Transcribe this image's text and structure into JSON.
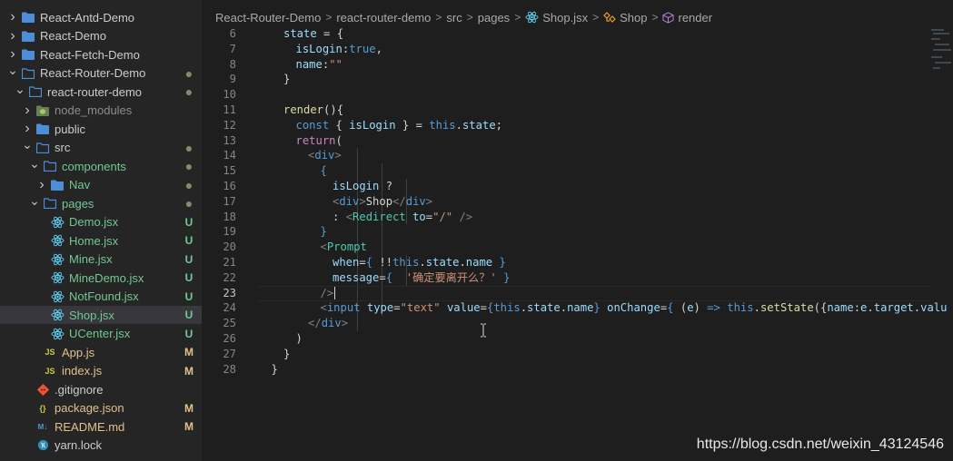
{
  "explorer": {
    "items": [
      {
        "label": "React-Antd-Demo",
        "type": "folder",
        "chevron": "right",
        "indent": 0
      },
      {
        "label": "React-Demo",
        "type": "folder",
        "chevron": "right",
        "indent": 0
      },
      {
        "label": "React-Fetch-Demo",
        "type": "folder",
        "chevron": "right",
        "indent": 0
      },
      {
        "label": "React-Router-Demo",
        "type": "folder-open",
        "chevron": "down",
        "indent": 0,
        "badge": "●"
      },
      {
        "label": "react-router-demo",
        "type": "folder-open",
        "chevron": "down",
        "indent": 1,
        "badge": "●"
      },
      {
        "label": "node_modules",
        "type": "folder-node",
        "chevron": "right",
        "indent": 2,
        "dim": true
      },
      {
        "label": "public",
        "type": "folder",
        "chevron": "right",
        "indent": 2
      },
      {
        "label": "src",
        "type": "folder-open",
        "chevron": "down",
        "indent": 2,
        "badge": "●"
      },
      {
        "label": "components",
        "type": "folder-open",
        "chevron": "down",
        "indent": 3,
        "badge": "●",
        "status": "U"
      },
      {
        "label": "Nav",
        "type": "folder",
        "chevron": "right",
        "indent": 4,
        "badge": "●",
        "status": "U"
      },
      {
        "label": "pages",
        "type": "folder-open",
        "chevron": "down",
        "indent": 3,
        "badge": "●",
        "status": "U"
      },
      {
        "label": "Demo.jsx",
        "type": "react",
        "indent": 4,
        "badge": "U",
        "status": "U"
      },
      {
        "label": "Home.jsx",
        "type": "react",
        "indent": 4,
        "badge": "U",
        "status": "U"
      },
      {
        "label": "Mine.jsx",
        "type": "react",
        "indent": 4,
        "badge": "U",
        "status": "U"
      },
      {
        "label": "MineDemo.jsx",
        "type": "react",
        "indent": 4,
        "badge": "U",
        "status": "U"
      },
      {
        "label": "NotFound.jsx",
        "type": "react",
        "indent": 4,
        "badge": "U",
        "status": "U"
      },
      {
        "label": "Shop.jsx",
        "type": "react",
        "indent": 4,
        "badge": "U",
        "status": "U",
        "selected": true
      },
      {
        "label": "UCenter.jsx",
        "type": "react",
        "indent": 4,
        "badge": "U",
        "status": "U"
      },
      {
        "label": "App.js",
        "type": "js",
        "indent": 3,
        "badge": "M",
        "status": "M"
      },
      {
        "label": "index.js",
        "type": "js",
        "indent": 3,
        "badge": "M",
        "status": "M"
      },
      {
        "label": ".gitignore",
        "type": "git",
        "indent": 2
      },
      {
        "label": "package.json",
        "type": "json",
        "indent": 2,
        "badge": "M",
        "status": "M"
      },
      {
        "label": "README.md",
        "type": "md",
        "indent": 2,
        "badge": "M",
        "status": "M"
      },
      {
        "label": "yarn.lock",
        "type": "yarn",
        "indent": 2
      }
    ]
  },
  "breadcrumb": {
    "items": [
      "React-Router-Demo",
      "react-router-demo",
      "src",
      "pages",
      "Shop.jsx",
      "Shop",
      "render"
    ],
    "separator": ">"
  },
  "editor": {
    "active_line": 23,
    "lines": [
      {
        "n": "6",
        "indent": 2,
        "tokens": [
          [
            "var",
            "state"
          ],
          [
            "pun",
            " = {"
          ]
        ]
      },
      {
        "n": "7",
        "indent": 3,
        "tokens": [
          [
            "var",
            "isLogin"
          ],
          [
            "pun",
            ":"
          ],
          [
            "kw",
            "true"
          ],
          [
            "pun",
            ","
          ]
        ]
      },
      {
        "n": "8",
        "indent": 3,
        "tokens": [
          [
            "var",
            "name"
          ],
          [
            "pun",
            ":"
          ],
          [
            "str",
            "\"\""
          ]
        ]
      },
      {
        "n": "9",
        "indent": 2,
        "tokens": [
          [
            "pun",
            "}"
          ]
        ]
      },
      {
        "n": "10",
        "indent": 0,
        "tokens": []
      },
      {
        "n": "11",
        "indent": 2,
        "tokens": [
          [
            "fn",
            "render"
          ],
          [
            "pun",
            "(){"
          ]
        ]
      },
      {
        "n": "12",
        "indent": 3,
        "tokens": [
          [
            "kw",
            "const"
          ],
          [
            "pun",
            " { "
          ],
          [
            "var",
            "isLogin"
          ],
          [
            "pun",
            " } = "
          ],
          [
            "kw",
            "this"
          ],
          [
            "pun",
            "."
          ],
          [
            "var",
            "state"
          ],
          [
            "pun",
            ";"
          ]
        ]
      },
      {
        "n": "13",
        "indent": 3,
        "tokens": [
          [
            "ctl",
            "return"
          ],
          [
            "pun",
            "("
          ]
        ]
      },
      {
        "n": "14",
        "indent": 4,
        "tokens": [
          [
            "tagp",
            "<"
          ],
          [
            "tag",
            "div"
          ],
          [
            "tagp",
            ">"
          ]
        ]
      },
      {
        "n": "15",
        "indent": 5,
        "tokens": [
          [
            "brace",
            "{"
          ]
        ]
      },
      {
        "n": "16",
        "indent": 6,
        "tokens": [
          [
            "var",
            "isLogin"
          ],
          [
            "pun",
            " ?"
          ]
        ]
      },
      {
        "n": "17",
        "indent": 6,
        "tokens": [
          [
            "tagp",
            "<"
          ],
          [
            "tag",
            "div"
          ],
          [
            "tagp",
            ">"
          ],
          [
            "pun",
            "Shop"
          ],
          [
            "tagp",
            "</"
          ],
          [
            "tag",
            "div"
          ],
          [
            "tagp",
            ">"
          ]
        ]
      },
      {
        "n": "18",
        "indent": 6,
        "tokens": [
          [
            "pun",
            ": "
          ],
          [
            "tagp",
            "<"
          ],
          [
            "comp",
            "Redirect"
          ],
          [
            "pun",
            " "
          ],
          [
            "attr",
            "to"
          ],
          [
            "pun",
            "="
          ],
          [
            "str",
            "\"/\""
          ],
          [
            "pun",
            " "
          ],
          [
            "tagp",
            "/>"
          ]
        ]
      },
      {
        "n": "19",
        "indent": 5,
        "tokens": [
          [
            "brace",
            "}"
          ]
        ]
      },
      {
        "n": "20",
        "indent": 5,
        "tokens": [
          [
            "tagp",
            "<"
          ],
          [
            "comp",
            "Prompt"
          ]
        ]
      },
      {
        "n": "21",
        "indent": 6,
        "tokens": [
          [
            "attr",
            "when"
          ],
          [
            "pun",
            "="
          ],
          [
            "brace",
            "{"
          ],
          [
            "pun",
            " !!"
          ],
          [
            "kw",
            "this"
          ],
          [
            "pun",
            "."
          ],
          [
            "var",
            "state"
          ],
          [
            "pun",
            "."
          ],
          [
            "var",
            "name"
          ],
          [
            "pun",
            " "
          ],
          [
            "brace",
            "}"
          ]
        ]
      },
      {
        "n": "22",
        "indent": 6,
        "tokens": [
          [
            "attr",
            "message"
          ],
          [
            "pun",
            "="
          ],
          [
            "brace",
            "{"
          ],
          [
            "pun",
            "  "
          ],
          [
            "str",
            "'确定要离开么？'"
          ],
          [
            "pun",
            " "
          ],
          [
            "brace",
            "}"
          ]
        ]
      },
      {
        "n": "23",
        "indent": 5,
        "tokens": [
          [
            "tagp",
            "/>"
          ]
        ]
      },
      {
        "n": "24",
        "indent": 5,
        "tokens": [
          [
            "tagp",
            "<"
          ],
          [
            "tag",
            "input"
          ],
          [
            "pun",
            " "
          ],
          [
            "attr",
            "type"
          ],
          [
            "pun",
            "="
          ],
          [
            "str",
            "\"text\""
          ],
          [
            "pun",
            " "
          ],
          [
            "attr",
            "value"
          ],
          [
            "pun",
            "="
          ],
          [
            "brace",
            "{"
          ],
          [
            "kw",
            "this"
          ],
          [
            "pun",
            "."
          ],
          [
            "var",
            "state"
          ],
          [
            "pun",
            "."
          ],
          [
            "var",
            "name"
          ],
          [
            "brace",
            "}"
          ],
          [
            "pun",
            " "
          ],
          [
            "attr",
            "onChange"
          ],
          [
            "pun",
            "="
          ],
          [
            "brace",
            "{"
          ],
          [
            "pun",
            " ("
          ],
          [
            "var",
            "e"
          ],
          [
            "pun",
            ") "
          ],
          [
            "kw",
            "=>"
          ],
          [
            "pun",
            " "
          ],
          [
            "kw",
            "this"
          ],
          [
            "pun",
            "."
          ],
          [
            "fn",
            "setState"
          ],
          [
            "pun",
            "({"
          ],
          [
            "var",
            "name"
          ],
          [
            "pun",
            ":"
          ],
          [
            "var",
            "e"
          ],
          [
            "pun",
            "."
          ],
          [
            "var",
            "target"
          ],
          [
            "pun",
            "."
          ],
          [
            "var",
            "valu"
          ]
        ]
      },
      {
        "n": "25",
        "indent": 4,
        "tokens": [
          [
            "tagp",
            "</"
          ],
          [
            "tag",
            "div"
          ],
          [
            "tagp",
            ">"
          ]
        ]
      },
      {
        "n": "26",
        "indent": 3,
        "tokens": [
          [
            "pun",
            ")"
          ]
        ]
      },
      {
        "n": "27",
        "indent": 2,
        "tokens": [
          [
            "pun",
            "}"
          ]
        ]
      },
      {
        "n": "28",
        "indent": 1,
        "tokens": [
          [
            "pun",
            "}"
          ]
        ]
      }
    ]
  },
  "watermark": "https://blog.csdn.net/weixin_43124546",
  "colors": {
    "folder": "#4e8ed8",
    "react": "#61dafb",
    "git": "#f05033",
    "json": "#cbcb41",
    "untracked": "#73c991",
    "modified": "#e2c08d"
  }
}
